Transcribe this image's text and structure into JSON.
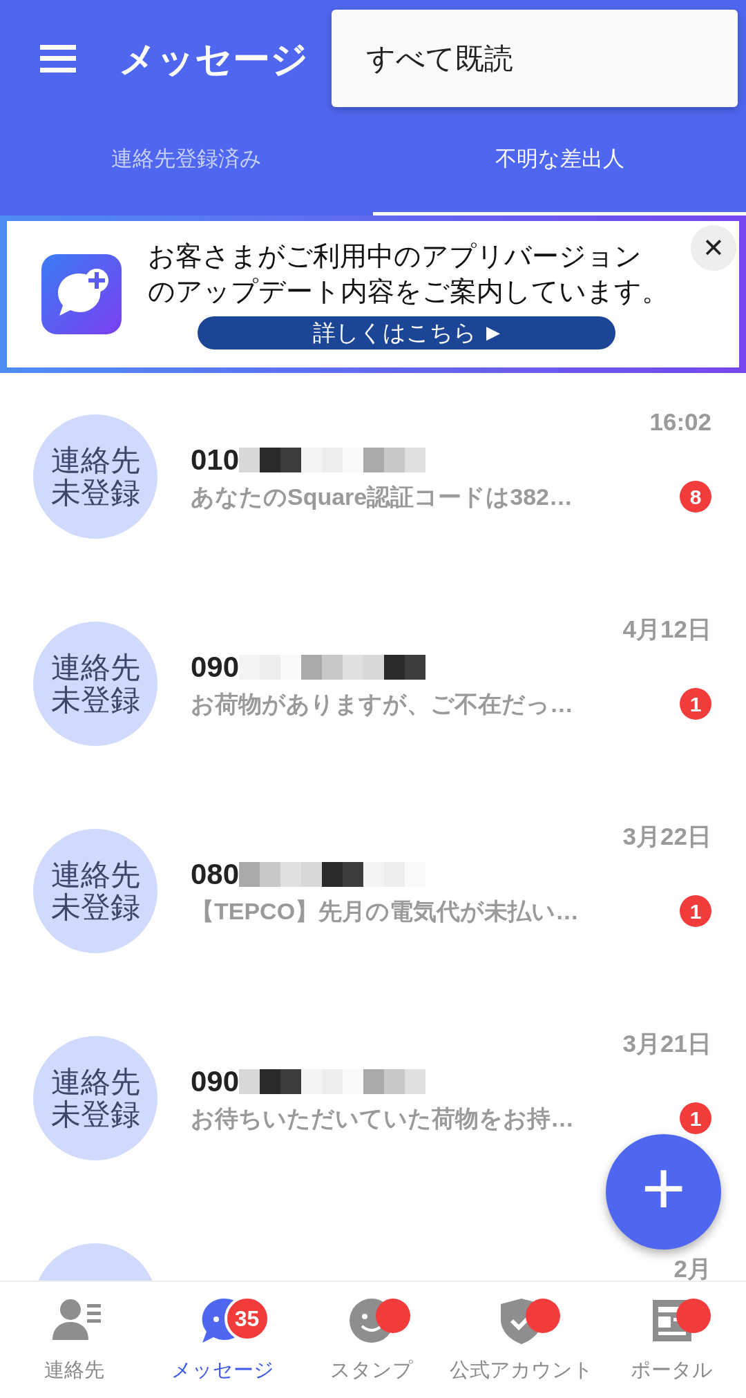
{
  "header": {
    "title": "メッセージ"
  },
  "menu": {
    "items": [
      "すべて既読"
    ]
  },
  "tabs": [
    {
      "label": "連絡先登録済み",
      "selected": false
    },
    {
      "label": "不明な差出人",
      "selected": true
    }
  ],
  "banner": {
    "lines": [
      "お客さまがご利用中のアプリバージョン",
      "のアップデート内容をご案内しています。"
    ],
    "button": "詳しくはこちら",
    "button_icon": "▶",
    "close": "✕"
  },
  "conversations": [
    {
      "avatar_lines": [
        "連絡先",
        "未登録"
      ],
      "name": "010",
      "redacted": true,
      "time": "16:02",
      "preview": "あなたのSquare認証コードは382…",
      "unread": "8"
    },
    {
      "avatar_lines": [
        "連絡先",
        "未登録"
      ],
      "name": "090",
      "redacted": true,
      "time": "4月12日",
      "preview": "お荷物がありますが、ご不在だっ…",
      "unread": "1"
    },
    {
      "avatar_lines": [
        "連絡先",
        "未登録"
      ],
      "name": "080",
      "redacted": true,
      "time": "3月22日",
      "preview": "【TEPCO】先月の電気代が未払い…",
      "unread": "1"
    },
    {
      "avatar_lines": [
        "連絡先",
        "未登録"
      ],
      "name": "090",
      "redacted": true,
      "time": "3月21日",
      "preview": "お待ちいただいていた荷物をお持…",
      "unread": "1"
    },
    {
      "redacted": false,
      "time": "2月"
    }
  ],
  "fab": {
    "icon": "+"
  },
  "nav": [
    {
      "label": "連絡先",
      "selected": false,
      "dot": false
    },
    {
      "label": "メッセージ",
      "selected": true,
      "badge": "35"
    },
    {
      "label": "スタンプ",
      "selected": false,
      "dot": true
    },
    {
      "label": "公式アカウント",
      "selected": false,
      "dot": true
    },
    {
      "label": "ポータル",
      "selected": false,
      "dot": true
    }
  ]
}
